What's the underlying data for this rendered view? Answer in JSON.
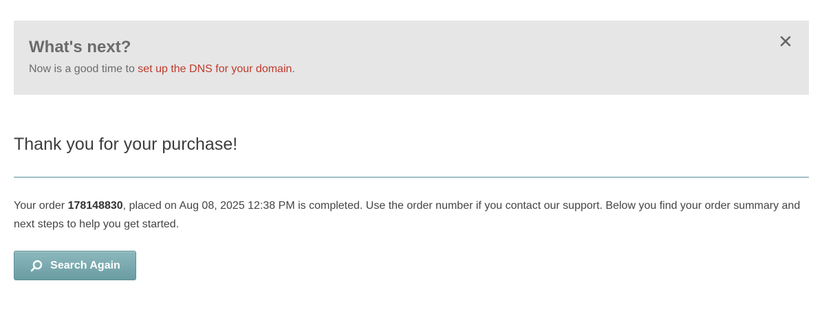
{
  "notice": {
    "title": "What's next?",
    "text_prefix": "Now is a good time to ",
    "link_text": "set up the DNS for your domain",
    "text_suffix": ".",
    "close_icon": "close-icon"
  },
  "main": {
    "title": "Thank you for your purchase!",
    "order_prefix": "Your order ",
    "order_number": "178148830",
    "order_suffix": ", placed on Aug 08, 2025 12:38 PM is completed. Use the order number if you contact our support. Below you find your order summary and next steps to help you get started.",
    "search_button_label": "Search Again",
    "search_icon": "search-icon"
  },
  "colors": {
    "link": "#c0392b",
    "button": "#7aabb0",
    "divider": "#9fc0c8",
    "notice_bg": "#e6e6e6"
  }
}
